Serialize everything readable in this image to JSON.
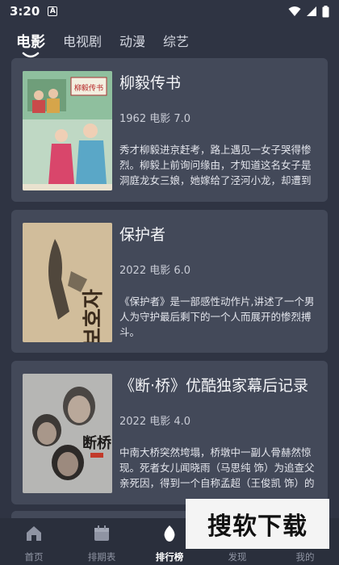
{
  "status": {
    "time": "3:20",
    "notification_badge": "A"
  },
  "tabs": [
    {
      "label": "电影"
    },
    {
      "label": "电视剧"
    },
    {
      "label": "动漫"
    },
    {
      "label": "综艺"
    }
  ],
  "movies": [
    {
      "title": "柳毅传书",
      "meta": "1962 电影 7.0",
      "description": "秀才柳毅进京赶考，路上遇见一女子哭得惨烈。柳毅上前询问缘由，才知道这名女子是洞庭龙女三娘，她嫁给了泾河小龙，却遭到了后者的虐待，宠情无…",
      "poster_text": "柳毅传书"
    },
    {
      "title": "保护者",
      "meta": "2022 电影 6.0",
      "description": "《保护者》是一部感性动作片,讲述了一个男人为守护最后剩下的一个人而展开的惨烈搏斗。",
      "poster_text": "보호자"
    },
    {
      "title": "《断·桥》优酷独家幕后记录",
      "meta": "2022 电影 4.0",
      "description": "中南大桥突然垮塌，桥墩中一副人骨赫然惊现。死者女儿闻晓雨（马思纯 饰）为追查父亲死因，得到一个自称孟超（王俊凯 饰）的男孩协助，并携手走…",
      "poster_text": "断桥"
    }
  ],
  "bottom_nav": [
    {
      "label": "首页",
      "icon": "home-icon"
    },
    {
      "label": "排期表",
      "icon": "calendar-icon"
    },
    {
      "label": "排行榜",
      "icon": "ranking-icon"
    },
    {
      "label": "发现",
      "icon": "discover-icon"
    },
    {
      "label": "我的",
      "icon": "profile-icon"
    }
  ],
  "watermark": "搜软下载",
  "colors": {
    "background": "#2f3443",
    "card": "#434959",
    "nav_active": "#ffffff",
    "nav_inactive": "#8f94a3"
  }
}
